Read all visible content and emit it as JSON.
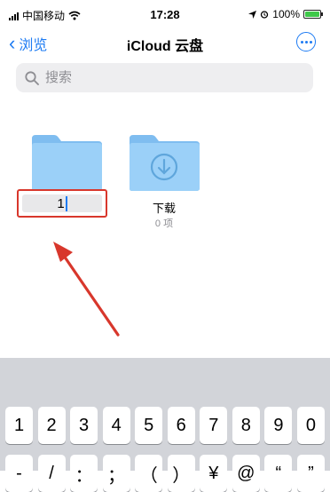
{
  "status": {
    "carrier": "中国移动",
    "time": "17:28",
    "battery_text": "100%",
    "battery_color": "#3fc84a"
  },
  "nav": {
    "back_label": "浏览",
    "title": "iCloud 云盘"
  },
  "search": {
    "placeholder": "搜索"
  },
  "folders": [
    {
      "name_value": "1",
      "editing": true,
      "icon": "folder-icon"
    },
    {
      "name": "下载",
      "count": "0 项",
      "icon": "folder-download-icon"
    }
  ],
  "keyboard": {
    "row1": [
      "1",
      "2",
      "3",
      "4",
      "5",
      "6",
      "7",
      "8",
      "9",
      "0"
    ],
    "row2": [
      "-",
      "/",
      "：",
      "；",
      "（",
      "）",
      "¥",
      "@",
      "“",
      "”"
    ]
  },
  "colors": {
    "accent": "#1d7bf3",
    "folder": "#8fc9f5",
    "annotation": "#d8372c"
  }
}
